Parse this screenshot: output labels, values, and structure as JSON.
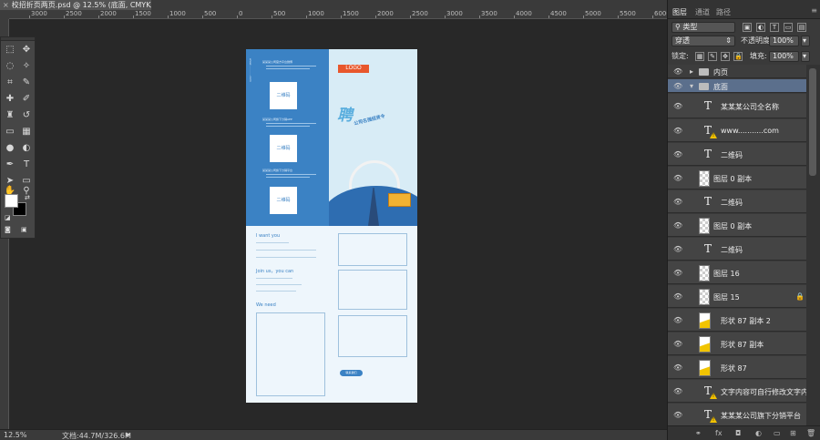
{
  "document": {
    "tab_title": "校招折页两页.psd @ 12.5% (底面, CMYK/8)",
    "close_glyph": "×",
    "zoom": "12.5%",
    "doc_size": "文档:44.7M/326.6M"
  },
  "ruler": {
    "h_labels": [
      "3000",
      "2500",
      "2000",
      "1500",
      "1000",
      "500",
      "0",
      "500",
      "1000",
      "1500",
      "2000",
      "2500",
      "3000",
      "3500",
      "4000",
      "4500",
      "5000",
      "5500",
      "6000"
    ]
  },
  "panel": {
    "tabs": [
      "图层",
      "通道",
      "路径"
    ],
    "filter_kind": "类型",
    "blend_mode": "穿透",
    "opacity_label": "不透明度:",
    "opacity_value": "100%",
    "lock_label": "锁定:",
    "fill_label": "填充:",
    "fill_value": "100%"
  },
  "layers": [
    {
      "name": "内页",
      "kind": "group"
    },
    {
      "name": "底面",
      "kind": "group-open"
    },
    {
      "name": "某某某公司全名称",
      "kind": "text"
    },
    {
      "name": "www...........com",
      "kind": "text-warn"
    },
    {
      "name": "二维码",
      "kind": "text"
    },
    {
      "name": "图层 0 副本",
      "kind": "pixel"
    },
    {
      "name": "二维码",
      "kind": "text"
    },
    {
      "name": "图层 0 副本",
      "kind": "pixel"
    },
    {
      "name": "二维码",
      "kind": "text"
    },
    {
      "name": "图层 16",
      "kind": "pixel"
    },
    {
      "name": "图层 15",
      "kind": "pixel-locked"
    },
    {
      "name": "形状 87 副本 2",
      "kind": "shape"
    },
    {
      "name": "形状 87 副本",
      "kind": "shape"
    },
    {
      "name": "形状 87",
      "kind": "shape"
    },
    {
      "name": "文字内容可自行修改文字内...",
      "kind": "text-warn"
    },
    {
      "name": "某某某公司旗下分销平台",
      "kind": "text-warn"
    },
    {
      "name": "文字内容可自行修改文字内...",
      "kind": "text-warn"
    }
  ],
  "flyer": {
    "logo": "LOGO",
    "headline": "聘",
    "slogan": "公司名强招贤令",
    "qr_label": "二维码",
    "left_items": [
      "某某某公司官方平台微博",
      "某某某公司旗下分销APP",
      "某某某公司旗下分销平台"
    ],
    "sections": [
      "I want you",
      "Join us，you can",
      "We need"
    ],
    "pill": "联系我们"
  }
}
